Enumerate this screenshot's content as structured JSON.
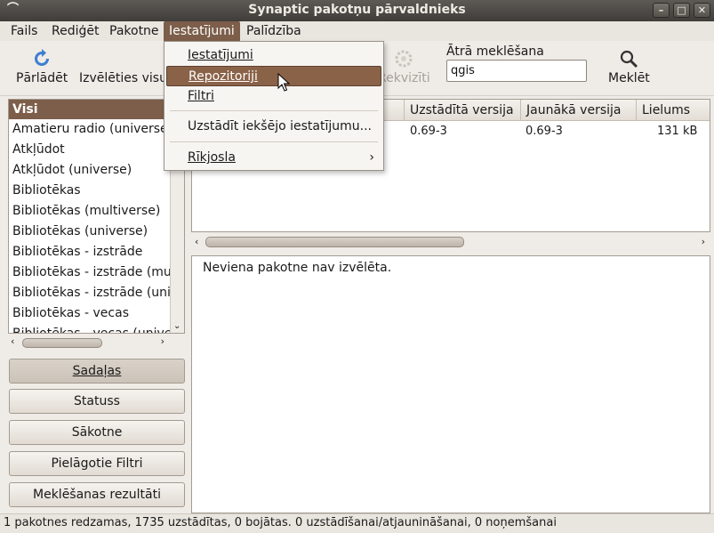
{
  "window": {
    "title": "Synaptic pakotņu pārvaldnieks"
  },
  "menubar": [
    "Fails",
    "Rediģēt",
    "Pakotne",
    "Iestatījumi",
    "Palīdzība"
  ],
  "toolbar": {
    "reload": "Pārlādēt",
    "mark_all": "Izvēlēties visu",
    "properties": "Rekvizīti",
    "search": "Meklēt"
  },
  "quick_search": {
    "label": "Ātrā meklēšana",
    "value": "qgis"
  },
  "dropdown": {
    "items": [
      "Iestatījumi",
      "Repozitoriji",
      "Filtri",
      "Uzstādīt iekšējo iestatījumu...",
      "Rīkjosla"
    ]
  },
  "categories": {
    "header": "Visi",
    "items": [
      "Amatieru radio (universe)",
      "Atkļūdot",
      "Atkļūdot (universe)",
      "Bibliotēkas",
      "Bibliotēkas (multiverse)",
      "Bibliotēkas (universe)",
      "Bibliotēkas - izstrāde",
      "Bibliotēkas - izstrāde (multiverse)",
      "Bibliotēkas - izstrāde (universe)",
      "Bibliotēkas - vecas",
      "Bibliotēkas - vecas (universe)"
    ]
  },
  "filter_buttons": [
    "Sadaļas",
    "Statuss",
    "Sākotne",
    "Pielāgotie Filtri",
    "Meklēšanas rezultāti"
  ],
  "table": {
    "columns": [
      "Uzstādītā versija",
      "Jaunākā versija",
      "Lielums"
    ],
    "row": {
      "installed": "0.69-3",
      "latest": "0.69-3",
      "size": "131 kB"
    }
  },
  "description": "Neviena pakotne nav izvēlēta.",
  "status": "1 pakotnes redzamas, 1735 uzstādītas, 0 bojātas. 0 uzstādīšanai/atjaunināšanai, 0 noņemšanai"
}
